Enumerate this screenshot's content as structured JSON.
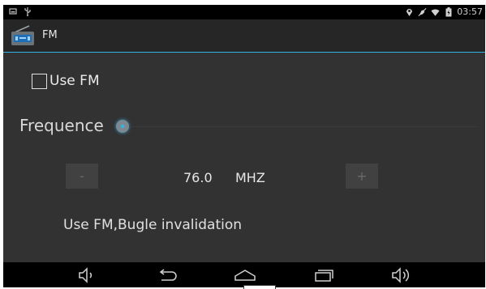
{
  "status_bar": {
    "time": "03:57",
    "left_icons": [
      "notification-icon",
      "usb-icon"
    ],
    "right_icons": [
      "location-icon",
      "mute-icon",
      "wifi-icon",
      "battery-icon"
    ]
  },
  "action_bar": {
    "title": "FM",
    "icon": "radio-icon",
    "accent_color": "#33b5e5"
  },
  "use_fm": {
    "label": "Use FM",
    "checked": false
  },
  "frequence": {
    "label": "Frequence"
  },
  "stepper": {
    "minus_label": "-",
    "plus_label": "+",
    "value": "76.0",
    "unit": "MHZ"
  },
  "note": {
    "text": "Use FM,Bugle invalidation"
  },
  "nav_bar": {
    "icons": [
      "volume-down-icon",
      "back-icon",
      "home-icon",
      "recent-apps-icon",
      "volume-up-icon"
    ]
  }
}
